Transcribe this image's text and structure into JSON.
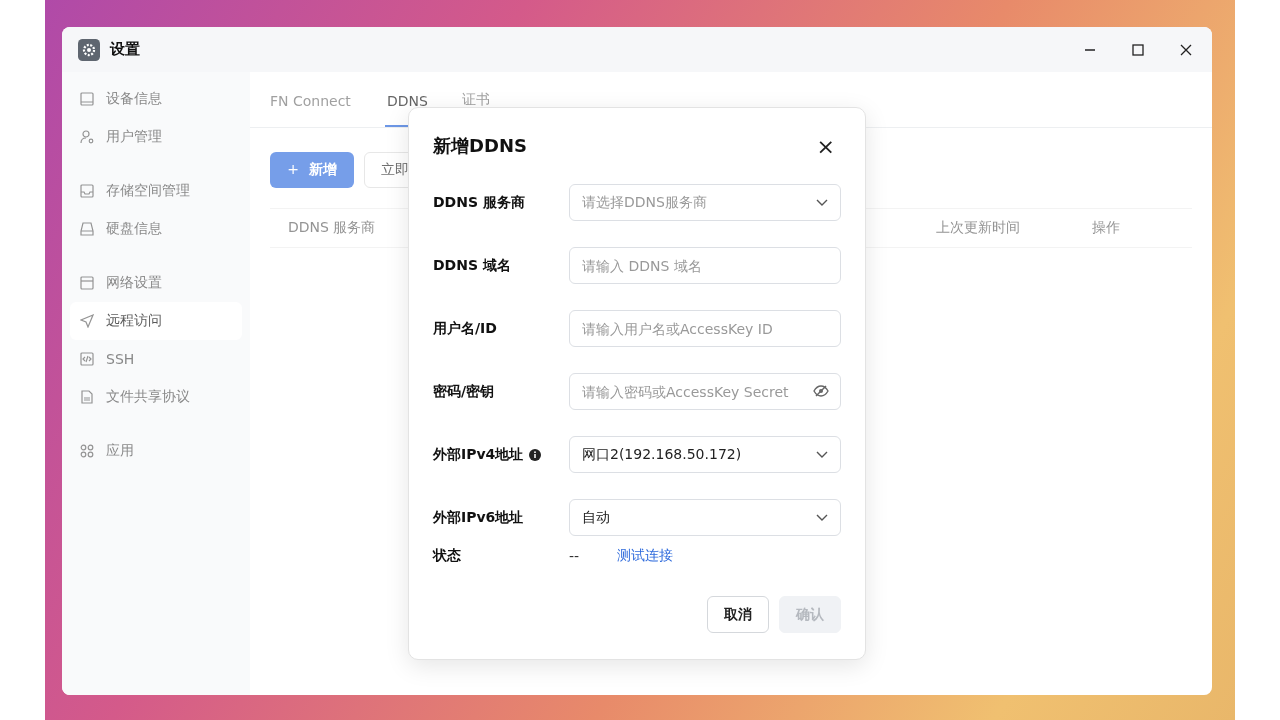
{
  "window": {
    "title": "设置"
  },
  "sidebar": {
    "groups": [
      {
        "items": [
          {
            "label": "设备信息",
            "selected": false
          },
          {
            "label": "用户管理",
            "selected": false
          }
        ]
      },
      {
        "items": [
          {
            "label": "存储空间管理",
            "selected": false
          },
          {
            "label": "硬盘信息",
            "selected": false
          }
        ]
      },
      {
        "items": [
          {
            "label": "网络设置",
            "selected": false
          },
          {
            "label": "远程访问",
            "selected": true
          },
          {
            "label": "SSH",
            "selected": false
          },
          {
            "label": "文件共享协议",
            "selected": false
          }
        ]
      },
      {
        "items": [
          {
            "label": "应用",
            "selected": false
          }
        ]
      }
    ]
  },
  "tabs": [
    {
      "label": "FN Connect",
      "selected": false
    },
    {
      "label": "DDNS",
      "selected": true
    },
    {
      "label": "证书",
      "selected": false
    }
  ],
  "toolbar": {
    "add_button": {
      "icon": "+",
      "label": "新增"
    },
    "update_button": {
      "label": "立即"
    }
  },
  "table": {
    "columns": [
      {
        "label": "DDNS 服务商"
      },
      {
        "label": "上次更新时间"
      },
      {
        "label": "操作"
      }
    ]
  },
  "dialog": {
    "title": "新增DDNS",
    "close": "×",
    "fields": [
      {
        "kind": "select",
        "label": "DDNS 服务商",
        "placeholder": "请选择DDNS服务商",
        "info": false
      },
      {
        "kind": "input",
        "label": "DDNS 域名",
        "placeholder": "请输入 DDNS 域名",
        "info": false
      },
      {
        "kind": "input",
        "label": "用户名/ID",
        "placeholder": "请输入用户名或AccessKey ID",
        "info": false
      },
      {
        "kind": "password",
        "label": "密码/密钥",
        "placeholder": "请输入密码或AccessKey Secret",
        "info": false
      },
      {
        "kind": "select",
        "label": "外部IPv4地址",
        "value": "网口2(192.168.50.172)",
        "info": true
      },
      {
        "kind": "select",
        "label": "外部IPv6地址",
        "value": "自动",
        "info": false
      }
    ],
    "status": {
      "label": "状态",
      "value": "--",
      "link": "测试连接"
    },
    "buttons": [
      {
        "label": "取消",
        "primary": false,
        "disabled": false
      },
      {
        "label": "确认",
        "primary": true,
        "disabled": true
      }
    ]
  }
}
